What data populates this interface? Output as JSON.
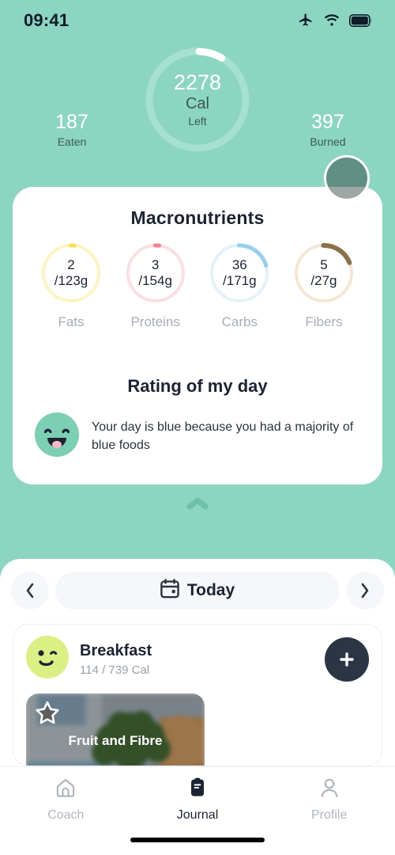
{
  "status_bar": {
    "time": "09:41",
    "icons": [
      "airplane-icon",
      "wifi-icon",
      "battery-icon"
    ]
  },
  "calories": {
    "remaining": "2278",
    "unit": "Cal",
    "state": "Left",
    "eaten_value": "187",
    "eaten_label": "Eaten",
    "burned_value": "397",
    "burned_label": "Burned",
    "ring_progress_pct": 8,
    "ring_track_color": "#a6e0cf",
    "ring_fill_color": "#ffffff"
  },
  "macronutrients": {
    "title": "Macronutrients",
    "items": [
      {
        "current": "2",
        "total": "/123g",
        "label": "Fats",
        "track": "#fdf4c4",
        "fill": "#f7e04a",
        "pct": 2
      },
      {
        "current": "3",
        "total": "/154g",
        "label": "Proteins",
        "track": "#fbdfe3",
        "fill": "#f97c8f",
        "pct": 2
      },
      {
        "current": "36",
        "total": "/171g",
        "label": "Carbs",
        "track": "#e2f1fa",
        "fill": "#97d0ef",
        "pct": 21
      },
      {
        "current": "5",
        "total": "/27g",
        "label": "Fibers",
        "track": "#f7e6d4",
        "fill": "#8c7248",
        "pct": 19
      }
    ]
  },
  "rating": {
    "title": "Rating of my day",
    "face_icon": "happy-face-icon",
    "face_color": "#7ccfb2",
    "message": "Your day is blue because you had a majority of blue foods"
  },
  "sheet_handle": "chevron-up-handle-icon",
  "date_nav": {
    "prev_icon": "chevron-left-icon",
    "next_icon": "chevron-right-icon",
    "calendar_icon": "calendar-icon",
    "label": "Today"
  },
  "meal": {
    "emoji_icon": "winking-face-icon",
    "emoji_color": "#dcef84",
    "name": "Breakfast",
    "calories": "114 / 739 Cal",
    "add_icon": "plus-icon",
    "food": {
      "star_icon": "star-icon",
      "name": "Fruit and Fibre"
    }
  },
  "tabs": [
    {
      "icon": "home-icon",
      "label": "Coach",
      "active": false
    },
    {
      "icon": "journal-icon",
      "label": "Journal",
      "active": true
    },
    {
      "icon": "profile-icon",
      "label": "Profile",
      "active": false
    }
  ],
  "theme": {
    "background": "#8CD5C0",
    "dark": "#2b3545"
  }
}
